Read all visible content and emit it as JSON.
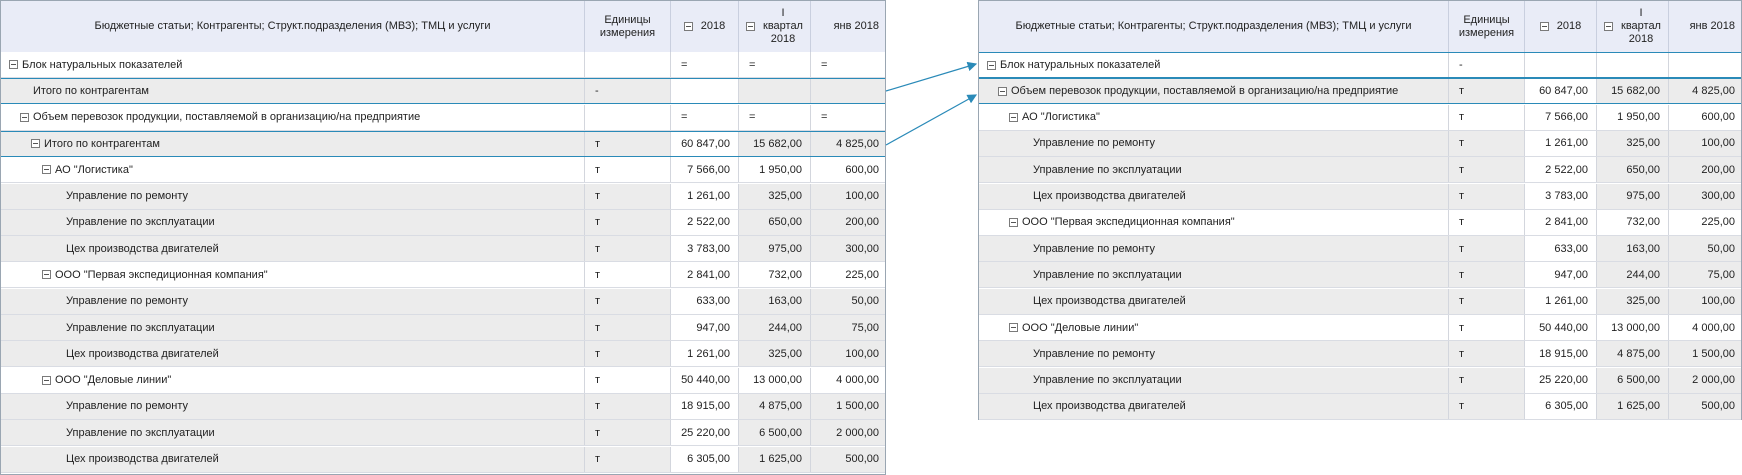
{
  "headers": {
    "dims": "Бюджетные статьи; Контрагенты; Структ.подразделения (МВЗ); ТМЦ и услуги",
    "units": "Единицы измерения",
    "y2018": "2018",
    "q1_line1": "I",
    "q1_line2": "квартал",
    "q1_line3": "2018",
    "jan": "янв 2018"
  },
  "left_rows": [
    {
      "label": "Блок натуральных показателей",
      "level": 0,
      "toggle": true,
      "unit": "",
      "v1": "=",
      "v2": "=",
      "v3": "=",
      "eq": true,
      "style": "white"
    },
    {
      "label": "Итого по контрагентам",
      "level": 1,
      "toggle": false,
      "unit": "-",
      "v1": "",
      "v2": "",
      "v3": "",
      "eq": false,
      "style": "gray",
      "sel": true
    },
    {
      "label": "Объем перевозок продукции, поставляемой в организацию/на предприятие",
      "level": 1,
      "toggle": true,
      "unit": "",
      "v1": "=",
      "v2": "=",
      "v3": "=",
      "eq": true,
      "style": "white"
    },
    {
      "label": "Итого по контрагентам",
      "level": 2,
      "toggle": true,
      "unit": "т",
      "v1": "60 847,00",
      "v2": "15 682,00",
      "v3": "4 825,00",
      "eq": false,
      "style": "gray",
      "sel": true
    },
    {
      "label": "АО \"Логистика\"",
      "level": 3,
      "toggle": true,
      "unit": "т",
      "v1": "7 566,00",
      "v2": "1 950,00",
      "v3": "600,00",
      "eq": false,
      "style": "white"
    },
    {
      "label": "Управление по ремонту",
      "level": 4,
      "toggle": false,
      "unit": "т",
      "v1": "1 261,00",
      "v2": "325,00",
      "v3": "100,00",
      "eq": false,
      "style": "gray"
    },
    {
      "label": "Управление по эксплуатации",
      "level": 4,
      "toggle": false,
      "unit": "т",
      "v1": "2 522,00",
      "v2": "650,00",
      "v3": "200,00",
      "eq": false,
      "style": "gray"
    },
    {
      "label": "Цех производства двигателей",
      "level": 4,
      "toggle": false,
      "unit": "т",
      "v1": "3 783,00",
      "v2": "975,00",
      "v3": "300,00",
      "eq": false,
      "style": "gray"
    },
    {
      "label": "ООО \"Первая экспедиционная компания\"",
      "level": 3,
      "toggle": true,
      "unit": "т",
      "v1": "2 841,00",
      "v2": "732,00",
      "v3": "225,00",
      "eq": false,
      "style": "white"
    },
    {
      "label": "Управление по ремонту",
      "level": 4,
      "toggle": false,
      "unit": "т",
      "v1": "633,00",
      "v2": "163,00",
      "v3": "50,00",
      "eq": false,
      "style": "gray"
    },
    {
      "label": "Управление по эксплуатации",
      "level": 4,
      "toggle": false,
      "unit": "т",
      "v1": "947,00",
      "v2": "244,00",
      "v3": "75,00",
      "eq": false,
      "style": "gray"
    },
    {
      "label": "Цех производства двигателей",
      "level": 4,
      "toggle": false,
      "unit": "т",
      "v1": "1 261,00",
      "v2": "325,00",
      "v3": "100,00",
      "eq": false,
      "style": "gray"
    },
    {
      "label": "ООО \"Деловые линии\"",
      "level": 3,
      "toggle": true,
      "unit": "т",
      "v1": "50 440,00",
      "v2": "13 000,00",
      "v3": "4 000,00",
      "eq": false,
      "style": "white"
    },
    {
      "label": "Управление по ремонту",
      "level": 4,
      "toggle": false,
      "unit": "т",
      "v1": "18 915,00",
      "v2": "4 875,00",
      "v3": "1 500,00",
      "eq": false,
      "style": "gray"
    },
    {
      "label": "Управление по эксплуатации",
      "level": 4,
      "toggle": false,
      "unit": "т",
      "v1": "25 220,00",
      "v2": "6 500,00",
      "v3": "2 000,00",
      "eq": false,
      "style": "gray"
    },
    {
      "label": "Цех производства двигателей",
      "level": 4,
      "toggle": false,
      "unit": "т",
      "v1": "6 305,00",
      "v2": "1 625,00",
      "v3": "500,00",
      "eq": false,
      "style": "gray"
    }
  ],
  "right_rows": [
    {
      "label": "Блок натуральных показателей",
      "level": 0,
      "toggle": true,
      "unit": "-",
      "v1": "",
      "v2": "",
      "v3": "",
      "eq": false,
      "style": "white",
      "sel": true
    },
    {
      "label": "Объем перевозок продукции, поставляемой в организацию/на предприятие",
      "level": 1,
      "toggle": true,
      "unit": "т",
      "v1": "60 847,00",
      "v2": "15 682,00",
      "v3": "4 825,00",
      "eq": false,
      "style": "gray",
      "sel": true
    },
    {
      "label": "АО \"Логистика\"",
      "level": 2,
      "toggle": true,
      "unit": "т",
      "v1": "7 566,00",
      "v2": "1 950,00",
      "v3": "600,00",
      "eq": false,
      "style": "white"
    },
    {
      "label": "Управление по ремонту",
      "level": 3,
      "toggle": false,
      "unit": "т",
      "v1": "1 261,00",
      "v2": "325,00",
      "v3": "100,00",
      "eq": false,
      "style": "gray"
    },
    {
      "label": "Управление по эксплуатации",
      "level": 3,
      "toggle": false,
      "unit": "т",
      "v1": "2 522,00",
      "v2": "650,00",
      "v3": "200,00",
      "eq": false,
      "style": "gray"
    },
    {
      "label": "Цех производства двигателей",
      "level": 3,
      "toggle": false,
      "unit": "т",
      "v1": "3 783,00",
      "v2": "975,00",
      "v3": "300,00",
      "eq": false,
      "style": "gray"
    },
    {
      "label": "ООО \"Первая экспедиционная компания\"",
      "level": 2,
      "toggle": true,
      "unit": "т",
      "v1": "2 841,00",
      "v2": "732,00",
      "v3": "225,00",
      "eq": false,
      "style": "white"
    },
    {
      "label": "Управление по ремонту",
      "level": 3,
      "toggle": false,
      "unit": "т",
      "v1": "633,00",
      "v2": "163,00",
      "v3": "50,00",
      "eq": false,
      "style": "gray"
    },
    {
      "label": "Управление по эксплуатации",
      "level": 3,
      "toggle": false,
      "unit": "т",
      "v1": "947,00",
      "v2": "244,00",
      "v3": "75,00",
      "eq": false,
      "style": "gray"
    },
    {
      "label": "Цех производства двигателей",
      "level": 3,
      "toggle": false,
      "unit": "т",
      "v1": "1 261,00",
      "v2": "325,00",
      "v3": "100,00",
      "eq": false,
      "style": "gray"
    },
    {
      "label": "ООО \"Деловые линии\"",
      "level": 2,
      "toggle": true,
      "unit": "т",
      "v1": "50 440,00",
      "v2": "13 000,00",
      "v3": "4 000,00",
      "eq": false,
      "style": "white"
    },
    {
      "label": "Управление по ремонту",
      "level": 3,
      "toggle": false,
      "unit": "т",
      "v1": "18 915,00",
      "v2": "4 875,00",
      "v3": "1 500,00",
      "eq": false,
      "style": "gray"
    },
    {
      "label": "Управление по эксплуатации",
      "level": 3,
      "toggle": false,
      "unit": "т",
      "v1": "25 220,00",
      "v2": "6 500,00",
      "v3": "2 000,00",
      "eq": false,
      "style": "gray"
    },
    {
      "label": "Цех производства двигателей",
      "level": 3,
      "toggle": false,
      "unit": "т",
      "v1": "6 305,00",
      "v2": "1 625,00",
      "v3": "500,00",
      "eq": false,
      "style": "gray"
    }
  ],
  "colors": {
    "accent": "#2a8ab8",
    "header_bg": "#e9ecf7",
    "row_gray": "#ececec"
  }
}
